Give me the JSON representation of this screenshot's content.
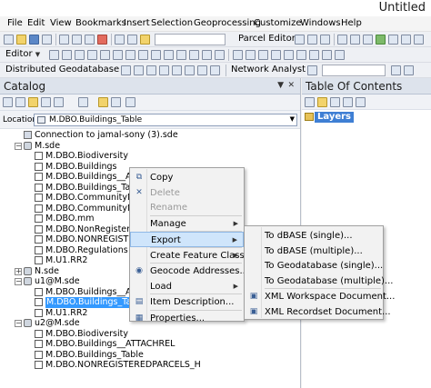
{
  "window": {
    "title": "Untitled"
  },
  "menu": [
    "File",
    "Edit",
    "View",
    "Bookmarks",
    "Insert",
    "Selection",
    "Geoprocessing",
    "Customize",
    "Windows",
    "Help"
  ],
  "toolbars": {
    "editor_label": "Editor",
    "parcel_editor_label": "Parcel Editor",
    "distributed_gdb_label": "Distributed Geodatabase",
    "network_analyst_label": "Network Analyst"
  },
  "catalog": {
    "title": "Catalog",
    "location_label": "Location:",
    "location_value": "M.DBO.Buildings_Table",
    "tree": [
      {
        "label": "Connection to jamal-sony (3).sde",
        "type": "conn",
        "level": 1,
        "expander": ""
      },
      {
        "label": "M.sde",
        "type": "db",
        "level": 1,
        "expander": "−"
      },
      {
        "label": "M.DBO.Biodiversity",
        "type": "table",
        "level": 2,
        "expander": ""
      },
      {
        "label": "M.DBO.Buildings",
        "type": "table",
        "level": 2,
        "expander": ""
      },
      {
        "label": "M.DBO.Buildings__ATTA",
        "type": "table",
        "level": 2,
        "expander": ""
      },
      {
        "label": "M.DBO.Buildings_Table",
        "type": "table",
        "level": 2,
        "expander": ""
      },
      {
        "label": "M.DBO.CommunityNam",
        "type": "table",
        "level": 2,
        "expander": ""
      },
      {
        "label": "M.DBO.CommunityNam",
        "type": "table",
        "level": 2,
        "expander": ""
      },
      {
        "label": "M.DBO.mm",
        "type": "table",
        "level": 2,
        "expander": ""
      },
      {
        "label": "M.DBO.NonRegisteredP",
        "type": "table",
        "level": 2,
        "expander": ""
      },
      {
        "label": "M.DBO.NONREGISTERE",
        "type": "table",
        "level": 2,
        "expander": ""
      },
      {
        "label": "M.DBO.Regulations",
        "type": "table",
        "level": 2,
        "expander": ""
      },
      {
        "label": "M.U1.RR2",
        "type": "table",
        "level": 2,
        "expander": ""
      },
      {
        "label": "N.sde",
        "type": "db",
        "level": 1,
        "expander": "+"
      },
      {
        "label": "u1@M.sde",
        "type": "db",
        "level": 1,
        "expander": "−"
      },
      {
        "label": "M.DBO.Buildings__ATTA",
        "type": "table",
        "level": 2,
        "expander": ""
      },
      {
        "label": "M.DBO.Buildings_Table",
        "type": "table",
        "level": 2,
        "expander": "",
        "selected": true
      },
      {
        "label": "M.U1.RR2",
        "type": "table",
        "level": 2,
        "expander": ""
      },
      {
        "label": "u2@M.sde",
        "type": "db",
        "level": 1,
        "expander": "−"
      },
      {
        "label": "M.DBO.Biodiversity",
        "type": "table",
        "level": 2,
        "expander": ""
      },
      {
        "label": "M.DBO.Buildings__ATTACHREL",
        "type": "table",
        "level": 2,
        "expander": ""
      },
      {
        "label": "M.DBO.Buildings_Table",
        "type": "table",
        "level": 2,
        "expander": ""
      },
      {
        "label": "M.DBO.NONREGISTEREDPARCELS_H",
        "type": "table",
        "level": 2,
        "expander": ""
      }
    ]
  },
  "toc": {
    "title": "Table Of Contents",
    "layers_label": "Layers"
  },
  "context_menu": [
    {
      "label": "Copy",
      "icon": "copy-icon",
      "glyph": "⧉",
      "disabled": false,
      "submenu": false
    },
    {
      "label": "Delete",
      "icon": "delete-icon",
      "glyph": "✕",
      "disabled": true,
      "submenu": false
    },
    {
      "label": "Rename",
      "icon": "",
      "glyph": "",
      "disabled": true,
      "submenu": false,
      "sep_after": true
    },
    {
      "label": "Manage",
      "icon": "",
      "glyph": "",
      "disabled": false,
      "submenu": true,
      "sep_after": true
    },
    {
      "label": "Export",
      "icon": "",
      "glyph": "",
      "disabled": false,
      "submenu": true,
      "highlighted": true,
      "sep_after": true
    },
    {
      "label": "Create Feature Class",
      "icon": "",
      "glyph": "",
      "disabled": false,
      "submenu": true,
      "sep_after": true
    },
    {
      "label": "Geocode Addresses...",
      "icon": "geocode-icon",
      "glyph": "◉",
      "disabled": false,
      "submenu": false
    },
    {
      "label": "Load",
      "icon": "",
      "glyph": "",
      "disabled": false,
      "submenu": true,
      "sep_after": true
    },
    {
      "label": "Item Description...",
      "icon": "item-description-icon",
      "glyph": "▤",
      "disabled": false,
      "submenu": false,
      "sep_after": true
    },
    {
      "label": "Properties...",
      "icon": "properties-icon",
      "glyph": "▦",
      "disabled": false,
      "submenu": false
    }
  ],
  "export_submenu": [
    {
      "label": "To dBASE (single)...",
      "icon": ""
    },
    {
      "label": "To dBASE (multiple)...",
      "icon": ""
    },
    {
      "label": "To Geodatabase (single)...",
      "icon": ""
    },
    {
      "label": "To Geodatabase (multiple)...",
      "icon": "",
      "sep_after": true
    },
    {
      "label": "XML Workspace Document...",
      "icon": "xml-workspace-icon"
    },
    {
      "label": "XML Recordset Document...",
      "icon": "xml-recordset-icon"
    }
  ]
}
